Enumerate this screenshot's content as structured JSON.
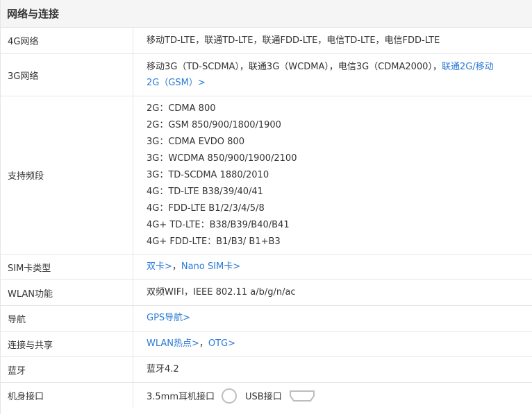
{
  "section": {
    "title": "网络与连接"
  },
  "rows": {
    "network_4g": {
      "label": "4G网络",
      "value": "移动TD-LTE，联通TD-LTE，联通FDD-LTE，电信TD-LTE，电信FDD-LTE"
    },
    "network_3g": {
      "label": "3G网络",
      "value_plain": "移动3G（TD-SCDMA），联通3G（WCDMA），电信3G（CDMA2000），",
      "value_link_1": "联通2G/移动",
      "value_link_2": "2G（GSM）>"
    },
    "bands": {
      "label": "支持频段",
      "lines": [
        "2G：CDMA 800",
        "2G：GSM 850/900/1800/1900",
        "3G：CDMA EVDO 800",
        "3G：WCDMA 850/900/1900/2100",
        "3G：TD-SCDMA 1880/2010",
        "4G：TD-LTE B38/39/40/41",
        "4G：FDD-LTE B1/2/3/4/5/8",
        "4G+ TD-LTE：B38/B39/B40/B41",
        "4G+ FDD-LTE：B1/B3/ B1+B3"
      ]
    },
    "sim": {
      "label": "SIM卡类型",
      "link_1": "双卡>",
      "separator": "，",
      "link_2": "Nano SIM卡>"
    },
    "wlan": {
      "label": "WLAN功能",
      "value": "双频WIFI，IEEE 802.11 a/b/g/n/ac"
    },
    "navigation": {
      "label": "导航",
      "link": "GPS导航>"
    },
    "connectivity": {
      "label": "连接与共享",
      "link_1": "WLAN热点>",
      "separator": "，",
      "link_2": "OTG>"
    },
    "bluetooth": {
      "label": "蓝牙",
      "value": "蓝牙4.2"
    },
    "ports": {
      "label": "机身接口",
      "jack_label": "3.5mm耳机接口",
      "jack_icon": "headphone-jack-icon",
      "usb_label": "USB接口",
      "usb_icon": "usb-port-icon"
    }
  },
  "colors": {
    "link": "#2a7ad6",
    "border": "#e6e6e6",
    "header_bg": "#f5f5f5",
    "text": "#333333"
  }
}
